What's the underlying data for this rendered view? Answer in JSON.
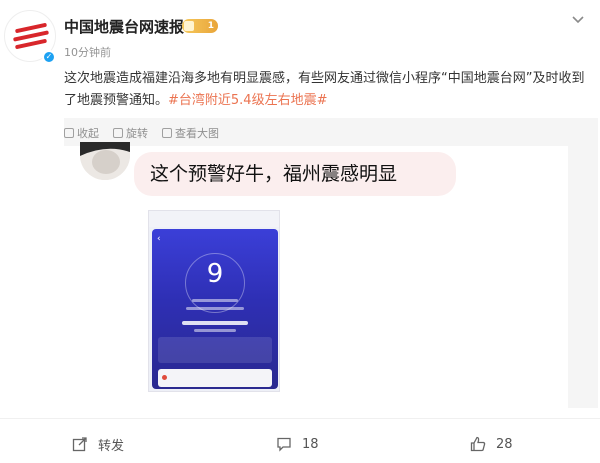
{
  "header": {
    "account_name": "中国地震台网速报",
    "vip_level": "1",
    "time_ago": "10分钟前",
    "more_icon": "chevron-down-icon"
  },
  "post": {
    "text_main": "这次地震造成福建沿海多地有明显震感，有些网友通过微信小程序“中国地震台网”及时收到了地震预警通知。",
    "hashtag": "#台湾附近5.4级左右地震#"
  },
  "media_tools": {
    "collapse": "收起",
    "rotate": "旋转",
    "view_large": "查看大图"
  },
  "image": {
    "comment_text": "这个预警好牛，福州震感明显",
    "phone_countdown": "9"
  },
  "actions": {
    "repost": "转发",
    "comments": "18",
    "likes": "28"
  },
  "colors": {
    "hashtag": "#eb7350",
    "brand_red": "#d8262b",
    "verify_blue": "#1da1f2",
    "bubble_pink": "#fbeeee",
    "screen_blue": "#3b3fd8"
  }
}
